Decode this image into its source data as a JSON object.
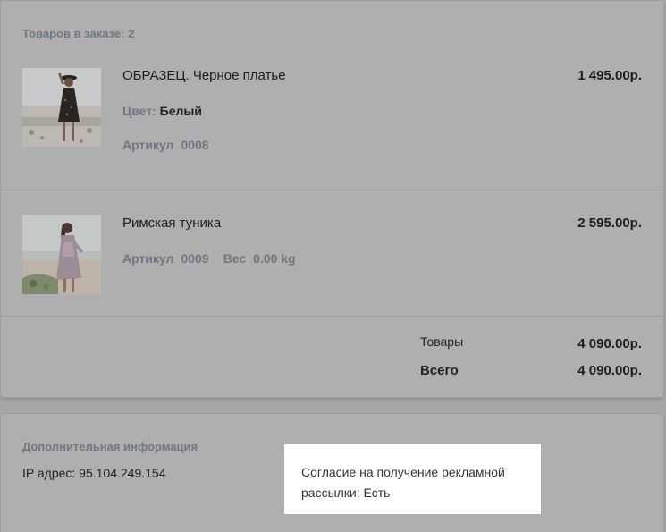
{
  "order": {
    "items_count_label": "Товаров в заказе: 2",
    "items": [
      {
        "name": "ОБРАЗЕЦ. Черное платье",
        "price": "1 495.00р.",
        "color_label": "Цвет:",
        "color_value": "Белый",
        "sku_label": "Артикул",
        "sku_value": "0008"
      },
      {
        "name": "Римская туника",
        "price": "2 595.00р.",
        "sku_label": "Артикул",
        "sku_value": "0009",
        "weight_label": "Вес",
        "weight_value": "0.00 kg"
      }
    ],
    "totals": {
      "goods_label": "Товары",
      "goods_value": "4 090.00р.",
      "total_label": "Всего",
      "total_value": "4 090.00р."
    }
  },
  "extra": {
    "title": "Дополнительная информация",
    "ip_text": "IP адрес: 95.104.249.154"
  },
  "tooltip": {
    "text": "Согласие на получение рекламной рассылки: Есть"
  }
}
